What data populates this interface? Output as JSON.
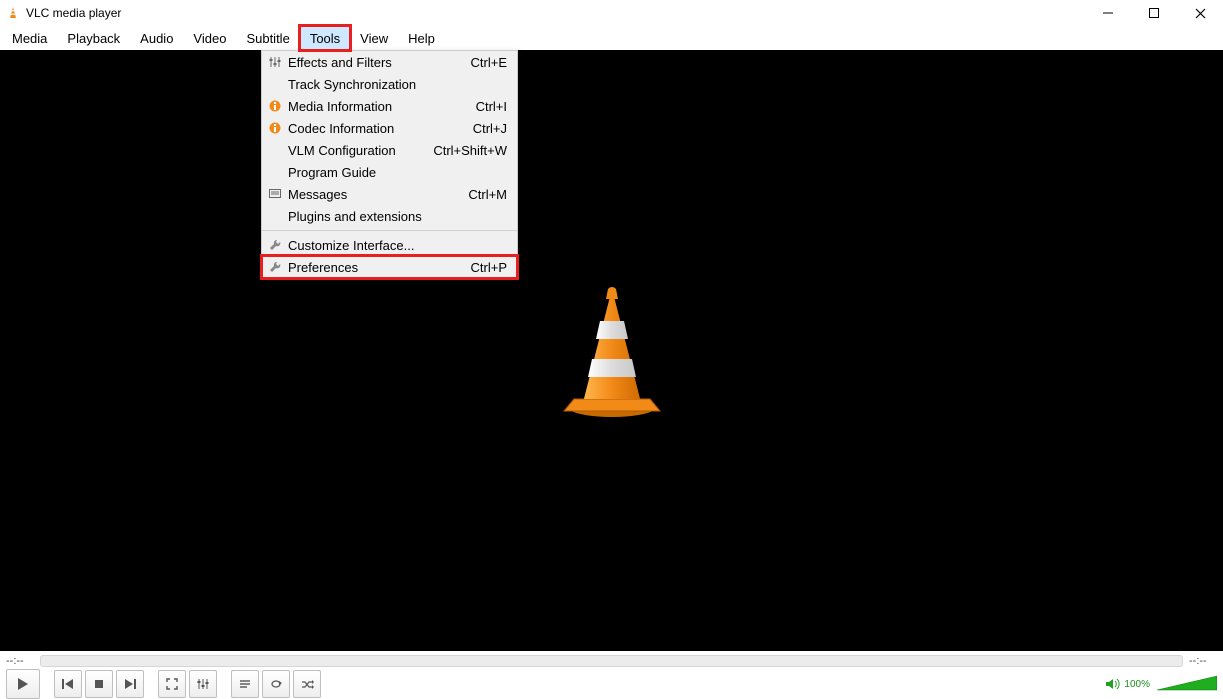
{
  "window": {
    "title": "VLC media player"
  },
  "menu": {
    "items": [
      {
        "label": "Media"
      },
      {
        "label": "Playback"
      },
      {
        "label": "Audio"
      },
      {
        "label": "Video"
      },
      {
        "label": "Subtitle"
      },
      {
        "label": "Tools",
        "active": true
      },
      {
        "label": "View"
      },
      {
        "label": "Help"
      }
    ]
  },
  "tools_menu": {
    "rows": [
      {
        "icon": "sliders",
        "label": "Effects and Filters",
        "shortcut": "Ctrl+E"
      },
      {
        "icon": "",
        "label": "Track Synchronization",
        "shortcut": ""
      },
      {
        "icon": "info",
        "label": "Media Information",
        "shortcut": "Ctrl+I"
      },
      {
        "icon": "info",
        "label": "Codec Information",
        "shortcut": "Ctrl+J"
      },
      {
        "icon": "",
        "label": "VLM Configuration",
        "shortcut": "Ctrl+Shift+W"
      },
      {
        "icon": "",
        "label": "Program Guide",
        "shortcut": ""
      },
      {
        "icon": "msg",
        "label": "Messages",
        "shortcut": "Ctrl+M"
      },
      {
        "icon": "",
        "label": "Plugins and extensions",
        "shortcut": ""
      },
      {
        "sep": true
      },
      {
        "icon": "wrench",
        "label": "Customize Interface...",
        "shortcut": ""
      },
      {
        "icon": "wrench",
        "label": "Preferences",
        "shortcut": "Ctrl+P",
        "highlight": true
      }
    ]
  },
  "status": {
    "elapsed": "--:--",
    "remaining": "--:--"
  },
  "volume": {
    "percent": "100%"
  },
  "colors": {
    "accent": "#e71f1f",
    "cone_orange": "#f28a18",
    "cone_stripe": "#d9d9d9"
  }
}
